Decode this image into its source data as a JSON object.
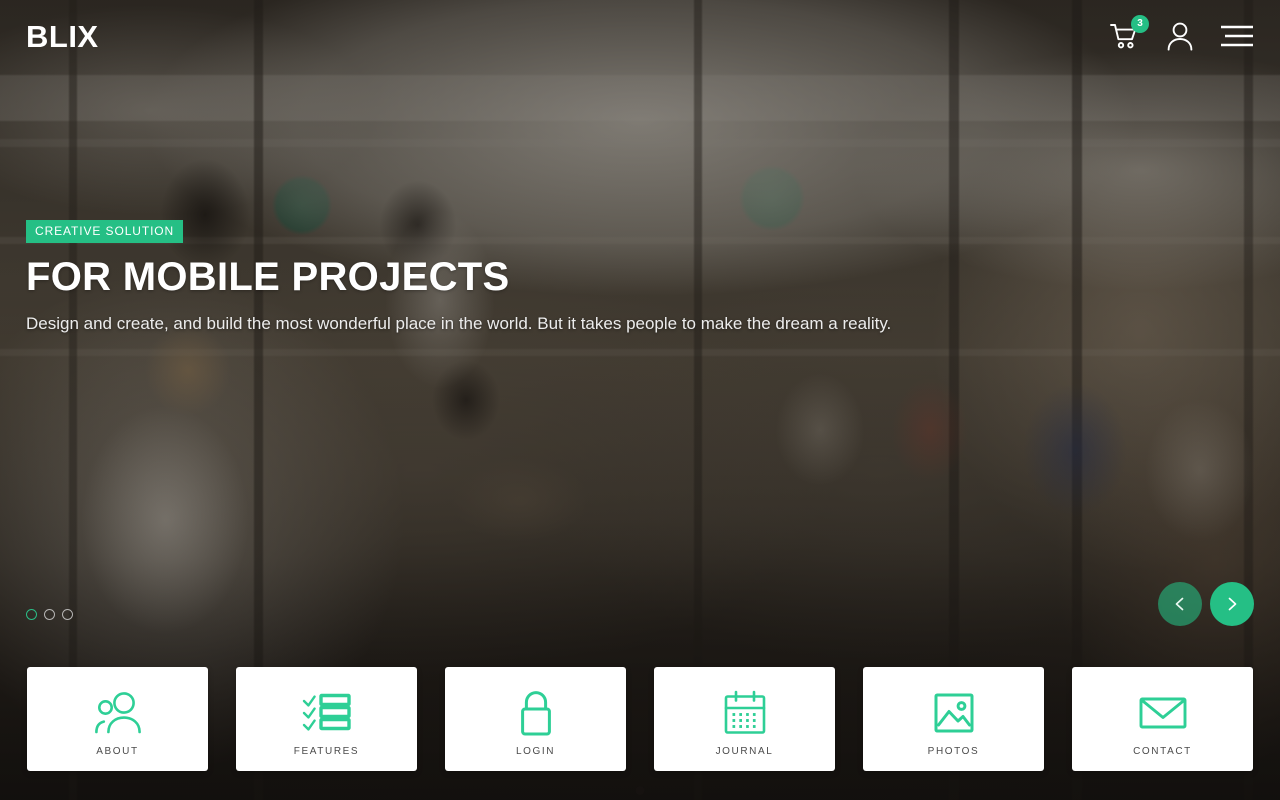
{
  "header": {
    "brand": "BLIX",
    "cart": {
      "icon": "shopping-cart-icon",
      "badge_count": "3"
    },
    "account": {
      "icon": "user-account-icon"
    },
    "menu": {
      "icon": "hamburger-menu-icon"
    }
  },
  "hero": {
    "eyebrow": "CREATIVE SOLUTION",
    "title": "FOR MOBILE PROJECTS",
    "subtitle": "Design and create, and build the most wonderful place in the world. But it takes people to make the dream a reality.",
    "slide_dots": [
      {
        "label": "1",
        "active": true
      },
      {
        "label": "2",
        "active": false
      },
      {
        "label": "3",
        "active": false
      }
    ],
    "carousel": {
      "prev_icon": "chevron-left-icon",
      "next_icon": "chevron-right-icon"
    }
  },
  "quick_nav": {
    "cards": [
      {
        "label": "ABOUT",
        "icon": "people-group-icon"
      },
      {
        "label": "FEATURES",
        "icon": "checklist-icon"
      },
      {
        "label": "LOGIN",
        "icon": "padlock-icon"
      },
      {
        "label": "JOURNAL",
        "icon": "calendar-icon"
      },
      {
        "label": "PHOTOS",
        "icon": "image-picture-icon"
      },
      {
        "label": "CONTACT",
        "icon": "envelope-mail-icon"
      }
    ]
  },
  "footer": {
    "scroll_dot": "scroll-indicator-dot"
  },
  "colors": {
    "accent_green": "#25bf85",
    "card_background": "#ffffff",
    "text_light": "#ffffff",
    "label_gray": "#4b4b4b"
  }
}
